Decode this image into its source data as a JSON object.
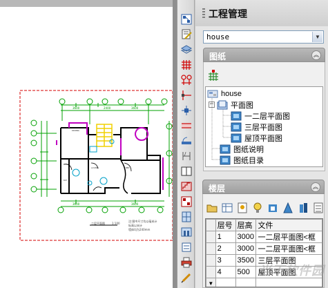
{
  "panel": {
    "title": "工程管理",
    "project_value": "house"
  },
  "drawings": {
    "header": "图纸",
    "collapse_icon": "chevron-up-icon",
    "tree": [
      {
        "label": "house",
        "level": 0,
        "icon": "project-icon"
      },
      {
        "label": "平面图",
        "level": 1,
        "icon": "folder-icon",
        "expander": "−"
      },
      {
        "label": "一二层平面图",
        "level": 2,
        "icon": "drawing-icon"
      },
      {
        "label": "三层平面图",
        "level": 2,
        "icon": "drawing-icon"
      },
      {
        "label": "屋顶平面图",
        "level": 2,
        "icon": "drawing-icon"
      },
      {
        "label": "图纸说明",
        "level": 1,
        "icon": "drawing-icon"
      },
      {
        "label": "图纸目录",
        "level": 1,
        "icon": "drawing-icon"
      }
    ]
  },
  "floors": {
    "header": "楼层",
    "collapse_icon": "chevron-up-icon",
    "columns": [
      "层号",
      "层高",
      "文件"
    ],
    "rows": [
      {
        "num": "1",
        "height": "3000",
        "file": "一二层平面图<框"
      },
      {
        "num": "2",
        "height": "3000",
        "file": "一二层平面图<框"
      },
      {
        "num": "3",
        "height": "3500",
        "file": "三层平面图"
      },
      {
        "num": "4",
        "height": "500",
        "file": "屋顶平面图"
      }
    ]
  },
  "watermark": "当下软件园",
  "colors": {
    "section_header": "#a8a8a8",
    "drawing_border": "#d40000",
    "cad_green": "#00a000",
    "cad_magenta": "#c000c0",
    "cad_yellow": "#f0d000"
  }
}
